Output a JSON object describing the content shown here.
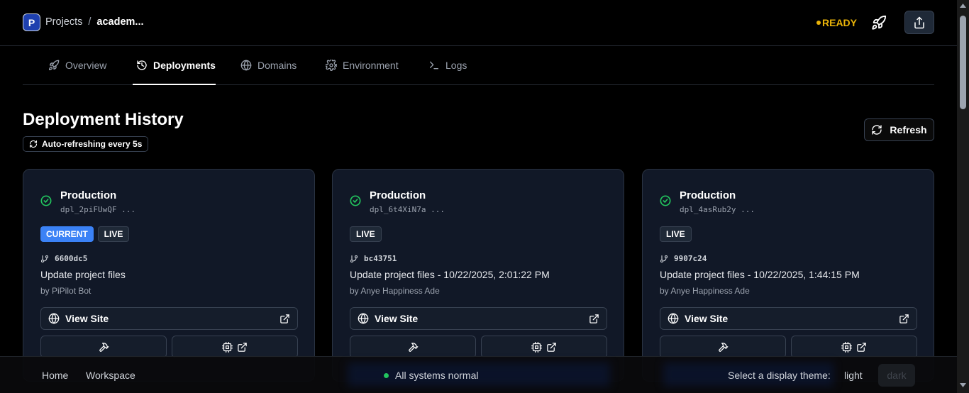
{
  "header": {
    "logo_letter": "P",
    "breadcrumb": {
      "root": "Projects",
      "separator": "/",
      "current": "academ..."
    },
    "status": "READY",
    "status_color": "#eab308"
  },
  "tabs": [
    {
      "label": "Overview",
      "icon": "rocket-icon"
    },
    {
      "label": "Deployments",
      "icon": "history-icon",
      "active": true
    },
    {
      "label": "Domains",
      "icon": "globe-icon"
    },
    {
      "label": "Environment",
      "icon": "gear-icon"
    },
    {
      "label": "Logs",
      "icon": "terminal-icon"
    }
  ],
  "page": {
    "title": "Deployment History",
    "auto_refresh": "Auto-refreshing every 5s",
    "refresh_label": "Refresh"
  },
  "deployments": [
    {
      "environment": "Production",
      "id": "dpl_2piFUwQF ...",
      "badges": [
        "CURRENT",
        "LIVE"
      ],
      "commit": "6600dc5",
      "message": "Update project files",
      "author": "by PiPilot Bot",
      "view_site": "View Site"
    },
    {
      "environment": "Production",
      "id": "dpl_6t4XiN7a ...",
      "badges": [
        "LIVE"
      ],
      "commit": "bc43751",
      "message": "Update project files - 10/22/2025, 2:01:22 PM",
      "author": "by Anye Happiness Ade",
      "view_site": "View Site"
    },
    {
      "environment": "Production",
      "id": "dpl_4asRub2y ...",
      "badges": [
        "LIVE"
      ],
      "commit": "9907c24",
      "message": "Update project files - 10/22/2025, 1:44:15 PM",
      "author": "by Anye Happiness Ade",
      "view_site": "View Site"
    }
  ],
  "footer": {
    "home": "Home",
    "workspace": "Workspace",
    "status": "All systems normal",
    "theme_label": "Select a display theme:",
    "theme_light": "light",
    "theme_dark": "dark"
  },
  "colors": {
    "accent": "#3b82f6",
    "success": "#22c55e",
    "card_bg": "#111827"
  }
}
